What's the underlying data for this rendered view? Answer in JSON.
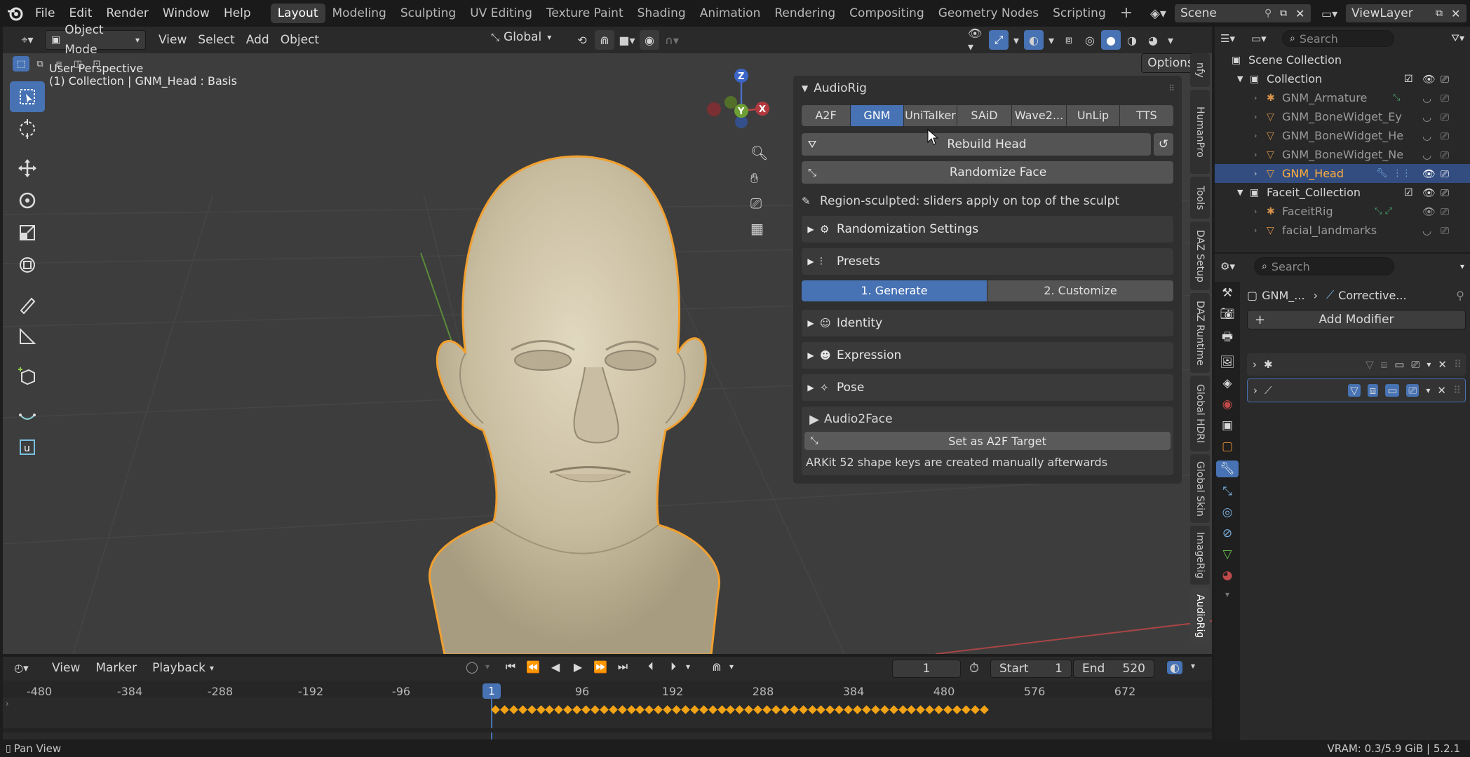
{
  "topbar": {
    "menus": [
      "File",
      "Edit",
      "Render",
      "Window",
      "Help"
    ],
    "workspaces": [
      "Layout",
      "Modeling",
      "Sculpting",
      "UV Editing",
      "Texture Paint",
      "Shading",
      "Animation",
      "Rendering",
      "Compositing",
      "Geometry Nodes",
      "Scripting"
    ],
    "active_workspace": "Layout",
    "add_tab": "+",
    "scene": "Scene",
    "view_layer": "ViewLayer"
  },
  "viewport_header": {
    "mode": "Object Mode",
    "menus": [
      "View",
      "Select",
      "Add",
      "Object"
    ],
    "orientation": "Global",
    "options": "Options"
  },
  "viewport": {
    "perspective": "User Perspective",
    "object_info": "(1) Collection | GNM_Head : Basis",
    "gizmo": {
      "z": "Z",
      "y": "Y",
      "x": "X"
    }
  },
  "npanel": {
    "title": "AudioRig",
    "tabs": [
      "A2F",
      "GNM",
      "UniTalker",
      "SAiD",
      "Wave2...",
      "UnLip",
      "TTS"
    ],
    "active_tab": "GNM",
    "rebuild": "Rebuild Head",
    "randomize": "Randomize Face",
    "note": "Region-sculpted: sliders apply on top of the sculpt",
    "rand_settings": "Randomization Settings",
    "presets": "Presets",
    "generate": "1. Generate",
    "customize": "2. Customize",
    "identity": "Identity",
    "expression": "Expression",
    "pose": "Pose",
    "a2f_header": "Audio2Face",
    "a2f_target": "Set as A2F Target",
    "arkit_note": "ARKit 52 shape keys are created manually afterwards",
    "side_tabs": [
      "nfy",
      "HumanPro",
      "Tools",
      "DAZ Setup",
      "DAZ Runtime",
      "Global HDRI",
      "Global Skin",
      "ImageRig",
      "AudioRig"
    ]
  },
  "outliner": {
    "search_placeholder": "Search",
    "scene_collection": "Scene Collection",
    "items": [
      {
        "label": "Collection",
        "level": 1
      },
      {
        "label": "GNM_Armature",
        "level": 2
      },
      {
        "label": "GNM_BoneWidget_Ey",
        "level": 2
      },
      {
        "label": "GNM_BoneWidget_He",
        "level": 2
      },
      {
        "label": "GNM_BoneWidget_Ne",
        "level": 2
      },
      {
        "label": "GNM_Head",
        "level": 2,
        "selected": true
      },
      {
        "label": "Faceit_Collection",
        "level": 1
      },
      {
        "label": "FaceitRig",
        "level": 2
      },
      {
        "label": "facial_landmarks",
        "level": 2
      }
    ]
  },
  "properties": {
    "search_placeholder": "Search",
    "breadcrumb_object": "GNM_...",
    "breadcrumb_modifier": "Corrective...",
    "add_modifier": "Add Modifier"
  },
  "timeline": {
    "menus": [
      "View",
      "Marker",
      "Playback"
    ],
    "current_frame": "1",
    "start_label": "Start",
    "start": "1",
    "end_label": "End",
    "end": "520",
    "ticks": [
      "-480",
      "-384",
      "-288",
      "-192",
      "-96",
      "1",
      "96",
      "192",
      "288",
      "384",
      "480",
      "576",
      "672"
    ]
  },
  "status": {
    "left": "Pan View",
    "right": "VRAM: 0.3/5.9 GiB | 5.2.1"
  },
  "colors": {
    "accent": "#4772b3",
    "selection_outline": "#f0a030",
    "keyframe": "#f2a316"
  }
}
